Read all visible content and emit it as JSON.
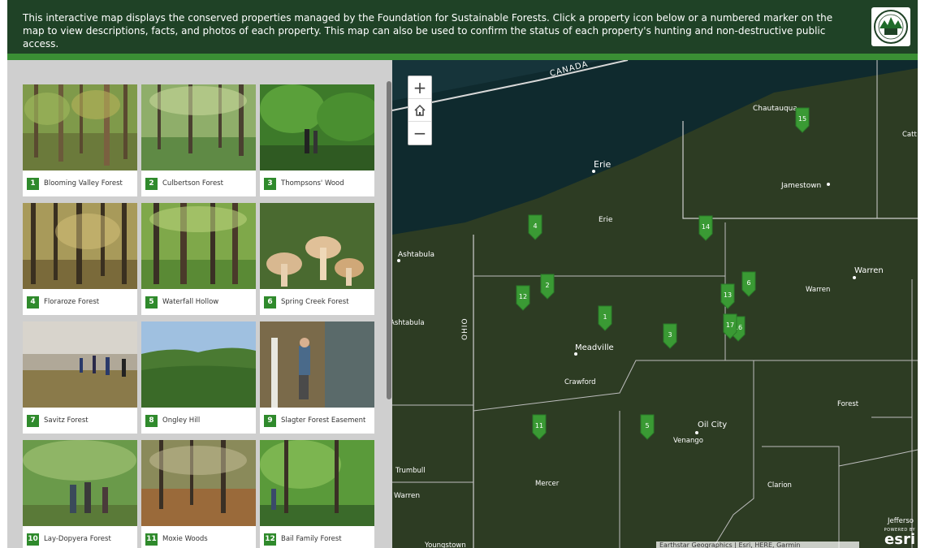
{
  "header": {
    "description": "This interactive map displays the conserved properties managed by the Foundation for Sustainable Forests. Click a property icon below or a numbered marker on the map to view descriptions, facts, and photos of each property. This map can also be used to confirm the status of each property's hunting and non-destructive public access.",
    "logo_icon": "forest-foundation-logo"
  },
  "colors": {
    "header_bg": "#1f4226",
    "accent_green": "#3a8f34",
    "marker_green": "#2f8a2c"
  },
  "gallery": {
    "cards": [
      {
        "num": "1",
        "label": "Blooming Valley Forest"
      },
      {
        "num": "2",
        "label": "Culbertson Forest"
      },
      {
        "num": "3",
        "label": "Thompsons' Wood"
      },
      {
        "num": "4",
        "label": "Floraroze Forest"
      },
      {
        "num": "5",
        "label": "Waterfall Hollow"
      },
      {
        "num": "6",
        "label": "Spring Creek Forest"
      },
      {
        "num": "7",
        "label": "Savitz Forest"
      },
      {
        "num": "8",
        "label": "Ongley Hill"
      },
      {
        "num": "9",
        "label": "Slagter Forest Easement"
      },
      {
        "num": "10",
        "label": "Lay-Dopyera Forest"
      },
      {
        "num": "11",
        "label": "Moxie Woods"
      },
      {
        "num": "12",
        "label": "Bail Family Forest"
      }
    ]
  },
  "map": {
    "zoom_in": "+",
    "home_icon": "home-icon",
    "zoom_out": "−",
    "places": [
      {
        "name": "CANADA",
        "kind": "country"
      },
      {
        "name": "Erie",
        "kind": "city-dot"
      },
      {
        "name": "Erie",
        "kind": "county"
      },
      {
        "name": "Chautauqua",
        "kind": "county"
      },
      {
        "name": "Jamestown",
        "kind": "city-dot"
      },
      {
        "name": "Ashtabula",
        "kind": "city-dot"
      },
      {
        "name": "Ashtabula",
        "kind": "county"
      },
      {
        "name": "OHIO",
        "kind": "state"
      },
      {
        "name": "Meadville",
        "kind": "city-dot"
      },
      {
        "name": "Crawford",
        "kind": "county"
      },
      {
        "name": "Warren",
        "kind": "city-dot"
      },
      {
        "name": "Warren",
        "kind": "county"
      },
      {
        "name": "Forest",
        "kind": "county"
      },
      {
        "name": "Oil City",
        "kind": "city-dot"
      },
      {
        "name": "Venango",
        "kind": "county"
      },
      {
        "name": "Trumbull",
        "kind": "county"
      },
      {
        "name": "Warren",
        "kind": "city"
      },
      {
        "name": "Mercer",
        "kind": "county"
      },
      {
        "name": "Clarion",
        "kind": "county"
      },
      {
        "name": "Jefferso",
        "kind": "county"
      },
      {
        "name": "Catt",
        "kind": "county"
      },
      {
        "name": "Youngstown",
        "kind": "city"
      }
    ],
    "markers": [
      "1",
      "2",
      "3",
      "4",
      "5",
      "6",
      "11",
      "12",
      "13",
      "14",
      "15",
      "16",
      "17"
    ],
    "attribution": "Earthstar Geographics | Esri, HERE, Garmin",
    "esri_powered": "POWERED BY",
    "esri_logo": "esri"
  }
}
